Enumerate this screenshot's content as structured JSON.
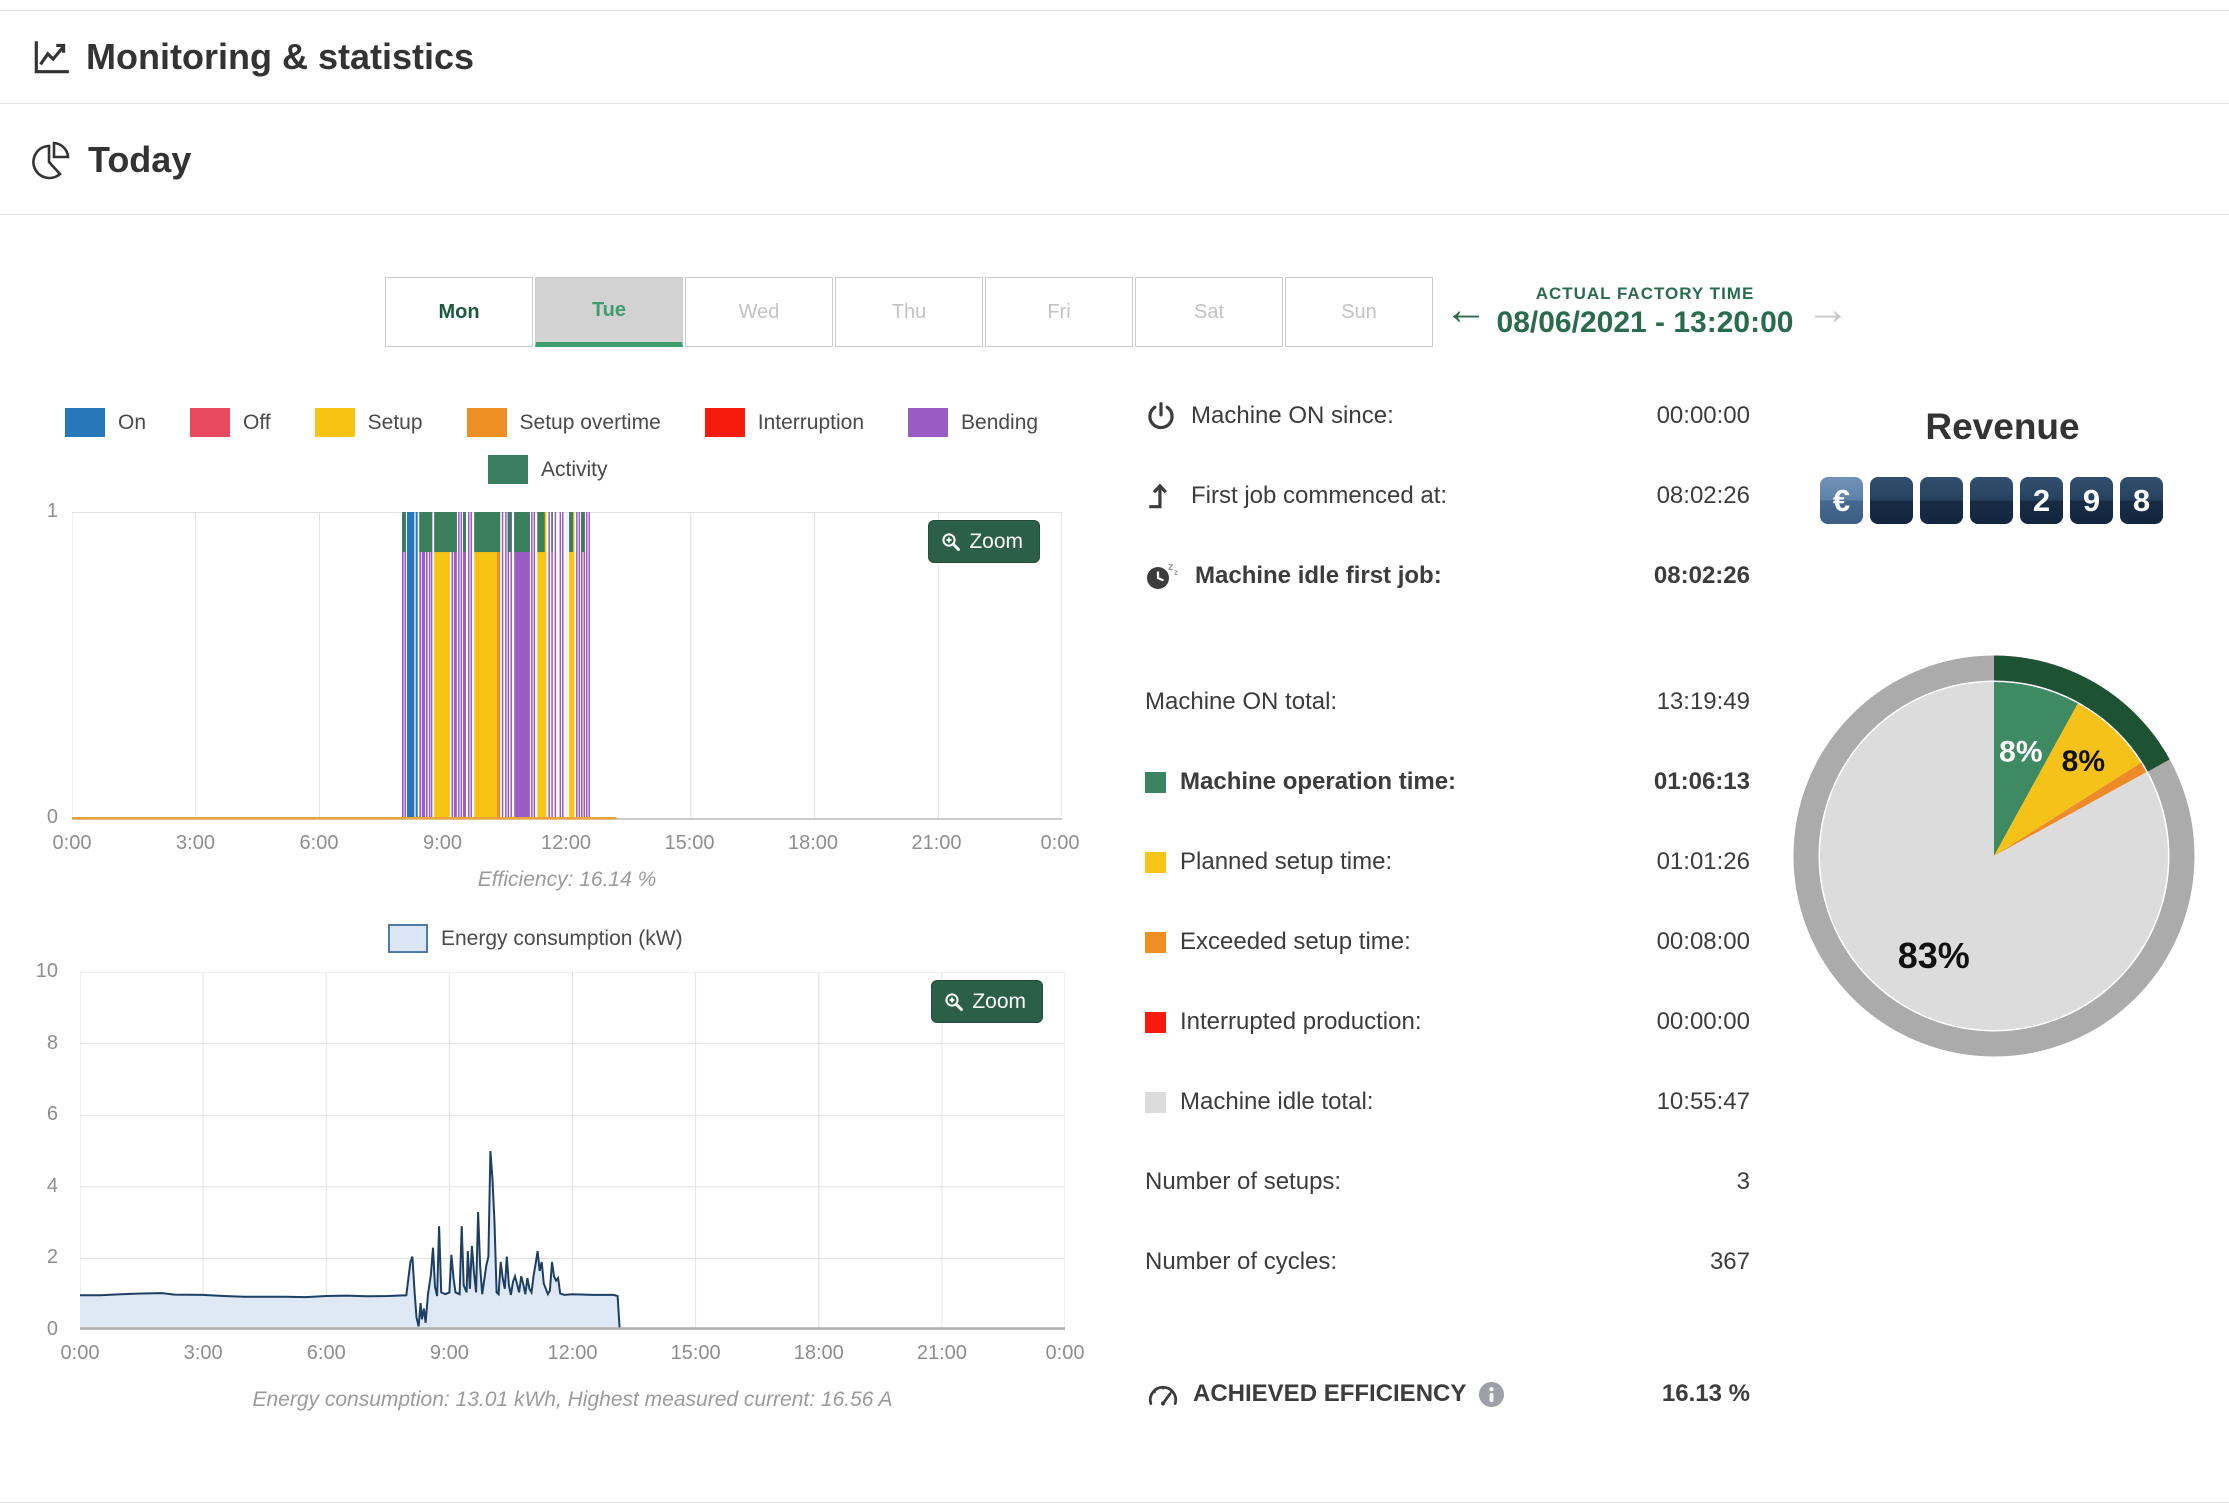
{
  "header": {
    "title": "Monitoring & statistics"
  },
  "section": {
    "title": "Today"
  },
  "tabs": [
    {
      "label": "Mon",
      "state": "past"
    },
    {
      "label": "Tue",
      "state": "selected"
    },
    {
      "label": "Wed",
      "state": "future"
    },
    {
      "label": "Thu",
      "state": "future"
    },
    {
      "label": "Fri",
      "state": "future"
    },
    {
      "label": "Sat",
      "state": "future"
    },
    {
      "label": "Sun",
      "state": "future"
    }
  ],
  "factory_time": {
    "label": "ACTUAL FACTORY TIME",
    "value": "08/06/2021 - 13:20:00"
  },
  "zoom_button_label": "Zoom",
  "chart_data": [
    {
      "id": "activity",
      "type": "timeline-bar",
      "title": "",
      "legend": [
        {
          "key": "on",
          "label": "On",
          "color": "#2878b9"
        },
        {
          "key": "off",
          "label": "Off",
          "color": "#e8495f"
        },
        {
          "key": "setup",
          "label": "Setup",
          "color": "#f7c414"
        },
        {
          "key": "setup_overtime",
          "label": "Setup overtime",
          "color": "#ee8f23"
        },
        {
          "key": "interruption",
          "label": "Interruption",
          "color": "#f61c0d"
        },
        {
          "key": "bending",
          "label": "Bending",
          "color": "#9a5bc5"
        },
        {
          "key": "activity",
          "label": "Activity",
          "color": "#3b7e5e"
        }
      ],
      "ylim": [
        0,
        1
      ],
      "yticks": [
        "1",
        "0"
      ],
      "xticks": [
        "0:00",
        "3:00",
        "6:00",
        "9:00",
        "12:00",
        "15:00",
        "18:00",
        "21:00",
        "0:00"
      ],
      "hours_span": 24,
      "caption": "Efficiency: 16.14 %",
      "activity_overlay_depth": 0.13,
      "bars": [
        [
          8.0,
          8.04,
          "bending"
        ],
        [
          8.06,
          8.09,
          "bending"
        ],
        [
          8.12,
          8.3,
          "on"
        ],
        [
          8.33,
          8.38,
          "on"
        ],
        [
          8.42,
          8.46,
          "bending"
        ],
        [
          8.48,
          8.56,
          "bending"
        ],
        [
          8.58,
          8.62,
          "bending"
        ],
        [
          8.65,
          8.68,
          "bending"
        ],
        [
          8.7,
          8.73,
          "bending"
        ],
        [
          8.78,
          9.16,
          "setup"
        ],
        [
          9.2,
          9.24,
          "bending"
        ],
        [
          9.26,
          9.33,
          "bending"
        ],
        [
          9.36,
          9.39,
          "bending"
        ],
        [
          9.42,
          9.45,
          "bending"
        ],
        [
          9.48,
          9.55,
          "bending"
        ],
        [
          9.6,
          9.62,
          "bending"
        ],
        [
          9.66,
          9.68,
          "bending"
        ],
        [
          9.75,
          10.3,
          "setup"
        ],
        [
          10.3,
          10.38,
          "setup_overtime"
        ],
        [
          10.42,
          10.45,
          "bending"
        ],
        [
          10.5,
          10.52,
          "bending"
        ],
        [
          10.56,
          10.58,
          "bending"
        ],
        [
          10.63,
          10.65,
          "bending"
        ],
        [
          10.72,
          11.1,
          "bending"
        ],
        [
          11.13,
          11.16,
          "bending"
        ],
        [
          11.19,
          11.22,
          "bending"
        ],
        [
          11.28,
          11.5,
          "setup"
        ],
        [
          11.55,
          11.58,
          "bending"
        ],
        [
          11.62,
          11.65,
          "bending"
        ],
        [
          11.7,
          11.72,
          "bending"
        ],
        [
          11.82,
          11.84,
          "bending"
        ],
        [
          11.88,
          11.9,
          "bending"
        ],
        [
          12.05,
          12.18,
          "setup"
        ],
        [
          12.22,
          12.24,
          "bending"
        ],
        [
          12.28,
          12.3,
          "bending"
        ],
        [
          12.34,
          12.36,
          "bending"
        ],
        [
          12.4,
          12.42,
          "bending"
        ],
        [
          12.46,
          12.48,
          "bending"
        ],
        [
          12.52,
          12.54,
          "bending"
        ]
      ],
      "activity_overlay": [
        [
          8.0,
          8.09
        ],
        [
          8.42,
          8.73
        ],
        [
          8.78,
          9.33
        ],
        [
          9.48,
          9.55
        ],
        [
          9.75,
          10.38
        ],
        [
          10.56,
          10.65
        ],
        [
          10.72,
          11.1
        ],
        [
          11.28,
          11.46
        ],
        [
          11.62,
          11.65
        ],
        [
          12.05,
          12.15
        ],
        [
          12.34,
          12.42
        ]
      ],
      "baseline_segment": {
        "start": 0,
        "end": 13.2,
        "color": "#eba437"
      },
      "grid_color": "#e3e3e3",
      "axis_color": "#b9b9b9"
    },
    {
      "id": "energy",
      "type": "area",
      "legend": [
        {
          "label": "Energy consumption (kW)",
          "fill": "#dce7f5",
          "stroke": "#4f7bab"
        }
      ],
      "ylim": [
        0,
        10
      ],
      "yticks": [
        "10",
        "8",
        "6",
        "4",
        "2",
        "0"
      ],
      "xticks": [
        "0:00",
        "3:00",
        "6:00",
        "9:00",
        "12:00",
        "15:00",
        "18:00",
        "21:00",
        "0:00"
      ],
      "hours_span": 24,
      "caption": "Energy consumption: 13.01 kWh, Highest measured current: 16.56 A",
      "line_color": "#1d3f63",
      "fill_color": "#dfe8f5",
      "grid_color": "#e3e3e3",
      "axis_color": "#b0b0b0",
      "points": [
        [
          0,
          0.97
        ],
        [
          0.5,
          0.97
        ],
        [
          1,
          1.0
        ],
        [
          1.5,
          1.02
        ],
        [
          2,
          1.03
        ],
        [
          2.3,
          0.99
        ],
        [
          3,
          0.98
        ],
        [
          3.5,
          0.95
        ],
        [
          4,
          0.93
        ],
        [
          5,
          0.93
        ],
        [
          5.5,
          0.92
        ],
        [
          6,
          0.95
        ],
        [
          6.5,
          0.96
        ],
        [
          7,
          0.94
        ],
        [
          7.5,
          0.95
        ],
        [
          7.95,
          0.97
        ],
        [
          8.05,
          1.9
        ],
        [
          8.1,
          2.05
        ],
        [
          8.15,
          1.1
        ],
        [
          8.2,
          0.35
        ],
        [
          8.25,
          0.1
        ],
        [
          8.3,
          0.75
        ],
        [
          8.33,
          0.3
        ],
        [
          8.38,
          0.6
        ],
        [
          8.42,
          0.2
        ],
        [
          8.48,
          1.0
        ],
        [
          8.55,
          1.55
        ],
        [
          8.6,
          2.3
        ],
        [
          8.65,
          1.2
        ],
        [
          8.7,
          0.95
        ],
        [
          8.75,
          2.9
        ],
        [
          8.8,
          1.05
        ],
        [
          8.9,
          1.0
        ],
        [
          9.0,
          1.05
        ],
        [
          9.05,
          2.1
        ],
        [
          9.1,
          1.45
        ],
        [
          9.15,
          1.05
        ],
        [
          9.25,
          1.0
        ],
        [
          9.3,
          2.9
        ],
        [
          9.35,
          1.25
        ],
        [
          9.42,
          1.05
        ],
        [
          9.45,
          2.2
        ],
        [
          9.5,
          1.15
        ],
        [
          9.55,
          2.35
        ],
        [
          9.6,
          1.6
        ],
        [
          9.65,
          1.05
        ],
        [
          9.7,
          3.3
        ],
        [
          9.75,
          1.75
        ],
        [
          9.8,
          1.0
        ],
        [
          9.9,
          1.8
        ],
        [
          9.95,
          2.05
        ],
        [
          10.0,
          5.0
        ],
        [
          10.05,
          4.2
        ],
        [
          10.1,
          3.0
        ],
        [
          10.15,
          1.05
        ],
        [
          10.2,
          1.0
        ],
        [
          10.25,
          1.9
        ],
        [
          10.3,
          1.45
        ],
        [
          10.35,
          1.15
        ],
        [
          10.4,
          2.05
        ],
        [
          10.45,
          1.25
        ],
        [
          10.5,
          0.98
        ],
        [
          10.55,
          1.35
        ],
        [
          10.6,
          1.5
        ],
        [
          10.65,
          1.28
        ],
        [
          10.7,
          1.05
        ],
        [
          10.75,
          1.5
        ],
        [
          10.8,
          1.28
        ],
        [
          10.85,
          1.0
        ],
        [
          10.9,
          1.45
        ],
        [
          10.95,
          1.15
        ],
        [
          11.0,
          1.05
        ],
        [
          11.05,
          1.5
        ],
        [
          11.1,
          1.85
        ],
        [
          11.15,
          2.2
        ],
        [
          11.2,
          1.65
        ],
        [
          11.25,
          1.9
        ],
        [
          11.3,
          1.3
        ],
        [
          11.35,
          1.15
        ],
        [
          11.4,
          1.0
        ],
        [
          11.45,
          1.1
        ],
        [
          11.5,
          1.9
        ],
        [
          11.55,
          1.5
        ],
        [
          11.6,
          1.38
        ],
        [
          11.65,
          1.45
        ],
        [
          11.7,
          1.02
        ],
        [
          11.8,
          0.98
        ],
        [
          12.0,
          1.0
        ],
        [
          12.5,
          0.98
        ],
        [
          13.0,
          0.98
        ],
        [
          13.1,
          0.95
        ],
        [
          13.15,
          0.02
        ]
      ]
    },
    {
      "id": "revenue-pie",
      "type": "pie",
      "slices": [
        {
          "label": "8%",
          "value": 8,
          "color": "#3e8a63",
          "label_color": "#ffffff"
        },
        {
          "label": "8%",
          "value": 8,
          "color": "#f5c21a",
          "label_color": "#111111"
        },
        {
          "label": "",
          "value": 1,
          "color": "#ee8a28",
          "label_color": "#111111"
        },
        {
          "label": "83%",
          "value": 83,
          "color": "#dcdcdc",
          "label_color": "#111111"
        }
      ],
      "ring_color": "#ababab",
      "ring_highlight_color": "#1d5233",
      "ring_highlight_fraction": 0.17,
      "legend_position": "none"
    }
  ],
  "stats": {
    "rows": [
      {
        "label": "Machine ON since:",
        "value": "00:00:00",
        "icon": "power"
      },
      {
        "label": "First job commenced at:",
        "value": "08:02:26",
        "icon": "first-job"
      },
      {
        "label": "Machine idle first job:",
        "value": "08:02:26",
        "icon": "idle",
        "bold": true
      },
      {
        "label": "Machine ON total:",
        "value": "13:19:49"
      },
      {
        "label": "Machine operation time:",
        "value": "01:06:13",
        "swatch": "#3b8462",
        "bold": true
      },
      {
        "label": "Planned setup time:",
        "value": "01:01:26",
        "swatch": "#f5c518"
      },
      {
        "label": "Exceeded setup time:",
        "value": "00:08:00",
        "swatch": "#ee8f23"
      },
      {
        "label": "Interrupted production:",
        "value": "00:00:00",
        "swatch": "#f61c0d"
      },
      {
        "label": "Machine idle total:",
        "value": "10:55:47",
        "swatch": "#dcdcdc"
      },
      {
        "label": "Number of setups:",
        "value": "3"
      },
      {
        "label": "Number of cycles:",
        "value": "367"
      }
    ],
    "efficiency": {
      "label": "ACHIEVED EFFICIENCY",
      "value": "16.13 %"
    }
  },
  "revenue": {
    "title": "Revenue",
    "currency_symbol": "€",
    "digits": [
      "",
      "",
      "",
      "2",
      "9",
      "8"
    ]
  },
  "colors": {
    "accent_green": "#2a6b4d",
    "tab_selected_green": "#3f9e70",
    "zoom_button_bg": "#2b5f47",
    "counter_box_navy": "#1c3551",
    "counter_euro_blue": "#5d81a8"
  }
}
